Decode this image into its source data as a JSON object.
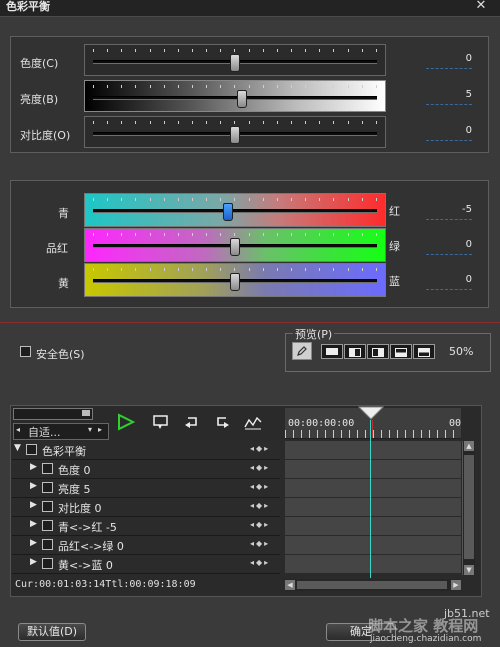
{
  "window": {
    "title": "色彩平衡",
    "close_label": "✕"
  },
  "basic": [
    {
      "label": "色度(C)",
      "value": "0",
      "level": 0.5
    },
    {
      "label": "亮度(B)",
      "value": "5",
      "level": 0.525
    },
    {
      "label": "对比度(O)",
      "value": "0",
      "level": 0.5
    }
  ],
  "channels": [
    {
      "left": "青",
      "right": "红",
      "value": "-5",
      "level": 0.475
    },
    {
      "left": "品红",
      "right": "绿",
      "value": "0",
      "level": 0.5
    },
    {
      "left": "黄",
      "right": "蓝",
      "value": "0",
      "level": 0.5
    }
  ],
  "safe_color": {
    "label": "安全色(S)"
  },
  "preview": {
    "label": "预览(P)",
    "zoom": "50%"
  },
  "keyframe": {
    "mode_label": "自适...",
    "tree": [
      {
        "label": "色彩平衡",
        "level": 0
      },
      {
        "label": "色度 0",
        "level": 1
      },
      {
        "label": "亮度 5",
        "level": 1
      },
      {
        "label": "对比度 0",
        "level": 1
      },
      {
        "label": "青<->红 -5",
        "level": 1
      },
      {
        "label": "品红<->绿 0",
        "level": 1
      },
      {
        "label": "黄<->蓝 0",
        "level": 1
      }
    ],
    "ruler_start": "00:00:00:00",
    "ruler_end": "00",
    "status": "Cur:00:01:03:14Ttl:00:09:18:09"
  },
  "buttons": {
    "default": "默认值(D)",
    "ok": "确定"
  },
  "watermark": {
    "line1": "jb51.net",
    "line2": "脚本之家 教程网",
    "line3": "jiaocheng.chazidian.com"
  },
  "colors": {
    "accent": "#3a6b9c",
    "divider": "#8b2a2a",
    "playhead": "#3ad6c8"
  },
  "icons": [
    "play-icon",
    "loop-icon",
    "undo-icon",
    "redo-icon",
    "curve-icon",
    "pencil-icon"
  ]
}
